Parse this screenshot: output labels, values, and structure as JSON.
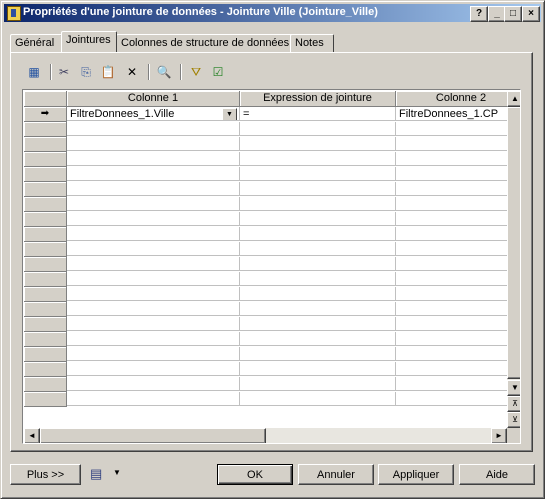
{
  "window": {
    "title": "Propriétés d'une jointure de données - Jointure Ville (Jointure_Ville)"
  },
  "title_buttons": {
    "help": "?",
    "minimize": "_",
    "maximize": "□",
    "close": "×"
  },
  "tabs": [
    {
      "label": "Général"
    },
    {
      "label": "Jointures"
    },
    {
      "label": "Colonnes de structure de données"
    },
    {
      "label": "Notes"
    }
  ],
  "toolbar": {
    "icons": [
      "add-rows-icon",
      "cut-icon",
      "copy-icon",
      "paste-icon",
      "delete-icon",
      "find-icon",
      "filter-icon",
      "customize-columns-icon"
    ],
    "glyphs": [
      "▦",
      "✂",
      "⎘",
      "📋",
      "✕",
      "🔍",
      "⛛",
      "☑"
    ]
  },
  "grid": {
    "columns": [
      "Colonne 1",
      "Expression de jointure",
      "Colonne 2"
    ],
    "current_row_marker": "➡",
    "rows": [
      [
        "FiltreDonnees_1.Ville",
        "=",
        "FiltreDonnees_1.CP"
      ]
    ],
    "empty_row_count": 19,
    "combo_arrow": "▼"
  },
  "scroll": {
    "up": "▲",
    "down": "▼",
    "left": "◄",
    "right": "►",
    "top": "⊼",
    "bottom": "⊻"
  },
  "buttons": {
    "more": "Plus >>",
    "ok": "OK",
    "cancel": "Annuler",
    "apply": "Appliquer",
    "help": "Aide",
    "print_arrow": "▼"
  }
}
